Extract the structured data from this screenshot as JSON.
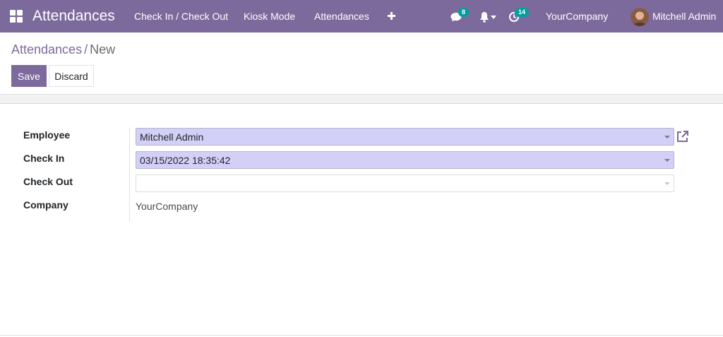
{
  "navbar": {
    "app_title": "Attendances",
    "menu": [
      {
        "label": "Check In / Check Out"
      },
      {
        "label": "Kiosk Mode"
      },
      {
        "label": "Attendances"
      }
    ],
    "messages_count": "8",
    "activities_count": "14",
    "company": "YourCompany",
    "user_name": "Mitchell Admin",
    "icons": [
      "apps-grid-icon",
      "plus-icon",
      "chat-icon",
      "bell-icon",
      "clock-icon",
      "avatar"
    ]
  },
  "breadcrumb": {
    "parent": "Attendances",
    "separator": "/",
    "current": "New"
  },
  "buttons": {
    "save": "Save",
    "discard": "Discard"
  },
  "form": {
    "employee_label": "Employee",
    "employee_value": "Mitchell Admin",
    "check_in_label": "Check In",
    "check_in_value": "03/15/2022 18:35:42",
    "check_out_label": "Check Out",
    "check_out_value": "",
    "company_label": "Company",
    "company_value": "YourCompany"
  },
  "colors": {
    "primary": "#7c6a9c",
    "badge": "#00a09d",
    "required_field": "#d2d0f7"
  }
}
